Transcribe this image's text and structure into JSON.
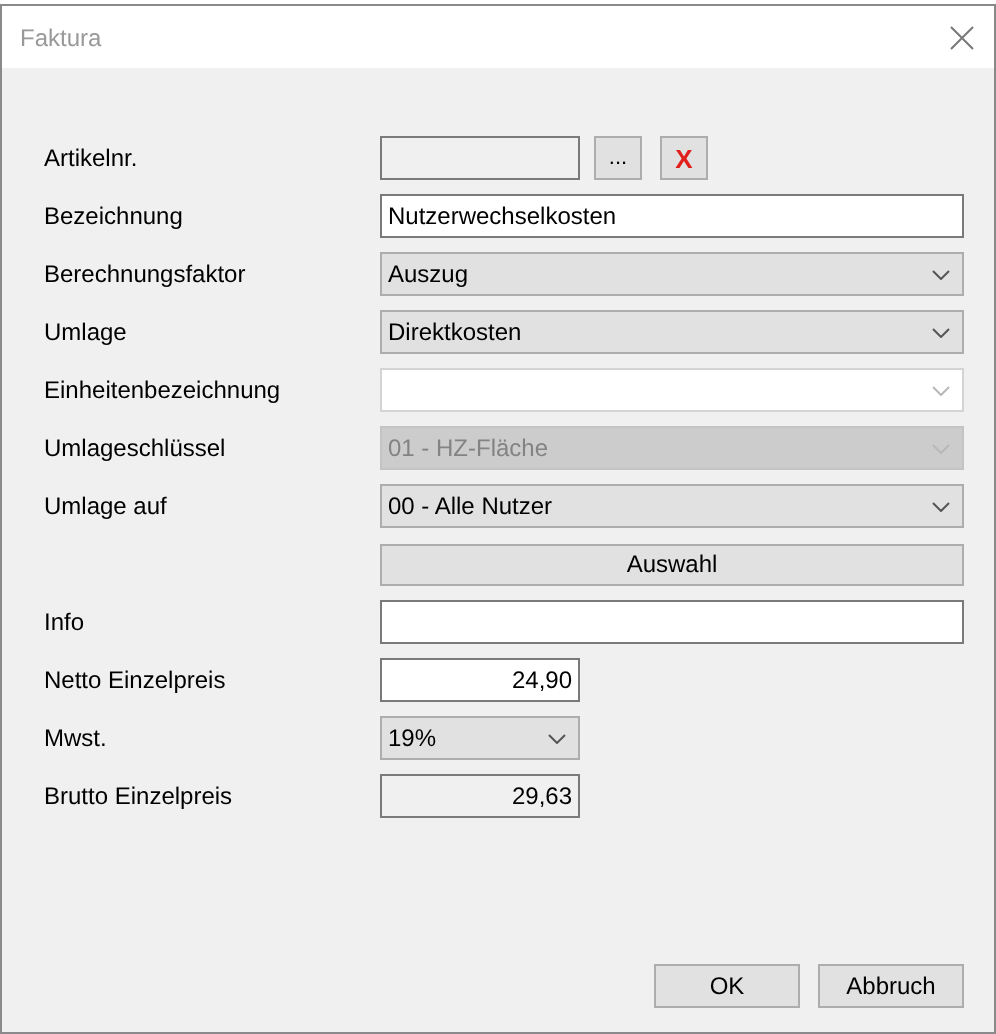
{
  "window": {
    "title": "Faktura"
  },
  "fields": [
    {
      "label": "Artikelnr.",
      "kind": "lookup",
      "readonly": true,
      "browse": "...",
      "clear": "X"
    },
    {
      "label": "Bezeichnung",
      "kind": "text",
      "value": "Nutzerwechselkosten",
      "readonly": false
    },
    {
      "label": "Berechnungsfaktor",
      "kind": "select",
      "value": "Auszug",
      "disabled": false
    },
    {
      "label": "Umlage",
      "kind": "select",
      "value": "Direktkosten",
      "disabled": false
    },
    {
      "label": "Einheitenbezeichnung",
      "kind": "combo",
      "disabled": true
    },
    {
      "label": "Umlageschlüssel",
      "kind": "select",
      "value": "01 - HZ-Fläche",
      "disabled": true
    },
    {
      "label": "Umlage auf",
      "kind": "select",
      "value": "00 - Alle Nutzer",
      "disabled": false
    },
    {
      "kind": "action",
      "value": "Auswahl"
    },
    {
      "label": "Info",
      "kind": "text",
      "readonly": false
    },
    {
      "label": "Netto Einzelpreis",
      "kind": "amount",
      "value": "24,90",
      "readonly": false
    },
    {
      "label": "Mwst.",
      "kind": "short-select",
      "value": "19%",
      "disabled": false
    },
    {
      "label": "Brutto Einzelpreis",
      "kind": "amount",
      "value": "29,63",
      "readonly": true
    }
  ],
  "buttons": [
    "OK",
    "Abbruch"
  ]
}
